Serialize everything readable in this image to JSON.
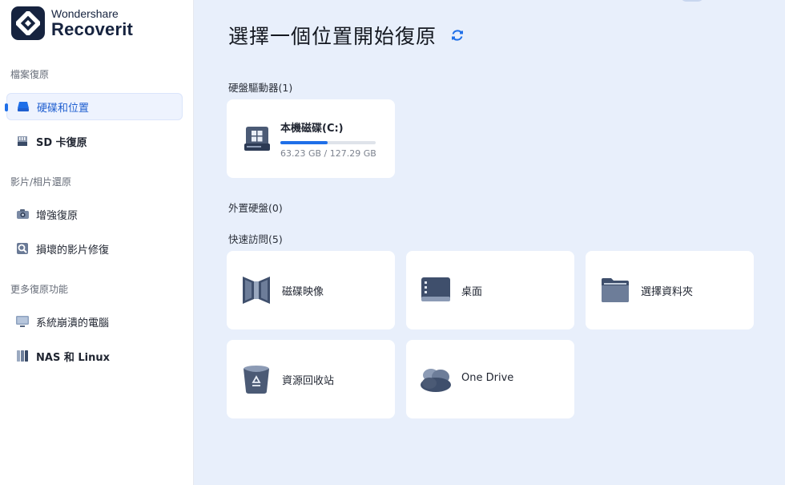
{
  "brand": {
    "top": "Wondershare",
    "main": "Recoverit"
  },
  "sidebar": {
    "sections": [
      {
        "label": "檔案復原",
        "items": [
          {
            "label": "硬碟和位置",
            "icon": "hard-drive-icon",
            "active": true
          },
          {
            "label": "SD 卡復原",
            "icon": "sd-card-icon",
            "active": false
          }
        ]
      },
      {
        "label": "影片/相片還原",
        "items": [
          {
            "label": "增強復原",
            "icon": "camera-icon",
            "active": false
          },
          {
            "label": "損壞的影片修復",
            "icon": "video-repair-icon",
            "active": false
          }
        ]
      },
      {
        "label": "更多復原功能",
        "items": [
          {
            "label": "系統崩潰的電腦",
            "icon": "monitor-icon",
            "active": false
          },
          {
            "label": "NAS 和 Linux",
            "icon": "nas-icon",
            "active": false
          }
        ]
      }
    ]
  },
  "main": {
    "title": "選擇一個位置開始復原",
    "hard_drives": {
      "label": "硬盤驅動器(1)",
      "drives": [
        {
          "name": "本機磁碟(C:)",
          "size": "63.23 GB / 127.29 GB",
          "used_fraction": 0.497
        }
      ]
    },
    "external": {
      "label": "外置硬盤(0)"
    },
    "quick_access": {
      "label": "快速訪問(5)",
      "items": [
        {
          "label": "磁碟映像",
          "icon": "disk-image-icon"
        },
        {
          "label": "桌面",
          "icon": "desktop-icon"
        },
        {
          "label": "選擇資料夾",
          "icon": "folder-icon"
        },
        {
          "label": "資源回收站",
          "icon": "recycle-bin-icon"
        },
        {
          "label": "One Drive",
          "icon": "onedrive-icon"
        }
      ]
    }
  },
  "colors": {
    "accent": "#1f6fe8",
    "sidebar_bg": "#ffffff",
    "main_bg": "#e8effb",
    "brand": "#16233f"
  }
}
